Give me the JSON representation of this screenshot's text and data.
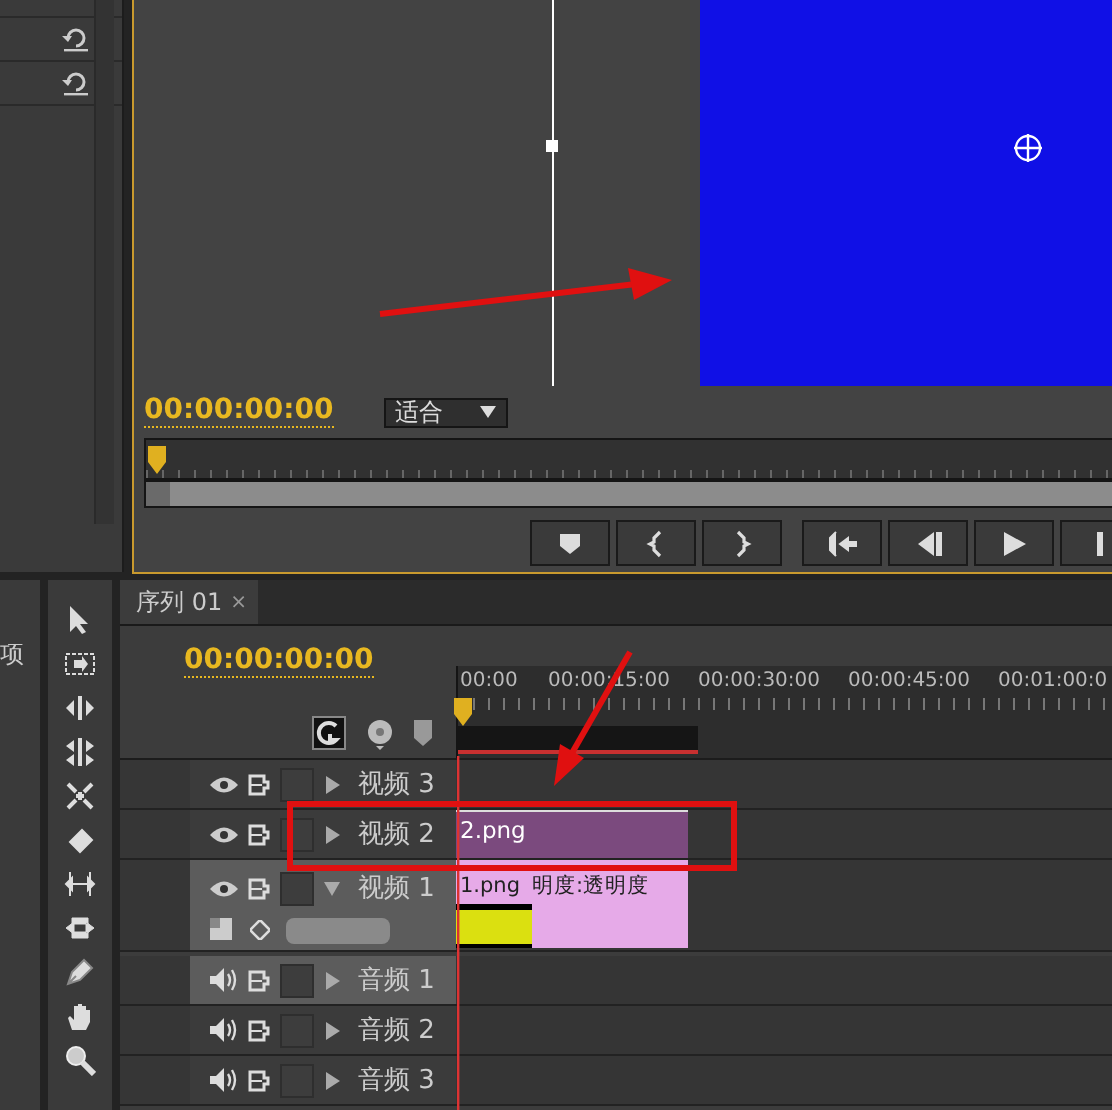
{
  "project_panel": {
    "text_fragment": "项"
  },
  "program_monitor": {
    "timecode": "00:00:00:00",
    "fit_select": {
      "value": "适合"
    },
    "transport_buttons": [
      {
        "kind": "marker"
      },
      {
        "kind": "mark-in"
      },
      {
        "kind": "mark-out"
      },
      {
        "kind": "go-to-in"
      },
      {
        "kind": "step-back"
      },
      {
        "kind": "play"
      },
      {
        "kind": "step-forward"
      }
    ]
  },
  "timeline": {
    "tab": {
      "title": "序列 01",
      "close": "×",
      "selected": true
    },
    "timecode": "00:00:00:00",
    "ruler_labels": [
      "00:00",
      "00:00:15:00",
      "00:00:30:00",
      "00:00:45:00",
      "00:01:00:0"
    ],
    "tracks": [
      {
        "kind": "video",
        "name": "视频 3",
        "expanded": false,
        "targeted": false
      },
      {
        "kind": "video",
        "name": "视频 2",
        "expanded": false,
        "targeted": false,
        "clips": [
          {
            "name": "2.png",
            "color": "#7b4a7e"
          }
        ]
      },
      {
        "kind": "video",
        "name": "视频 1",
        "expanded": true,
        "targeted": true,
        "clips": [
          {
            "name": "1.png",
            "effect": "明度:透明度",
            "color": "#e6aae8"
          }
        ]
      },
      {
        "kind": "audio",
        "name": "音频 1",
        "expanded": false,
        "targeted": true
      },
      {
        "kind": "audio",
        "name": "音频 2",
        "expanded": false,
        "targeted": false
      },
      {
        "kind": "audio",
        "name": "音频 3",
        "expanded": false,
        "targeted": false
      }
    ]
  }
}
